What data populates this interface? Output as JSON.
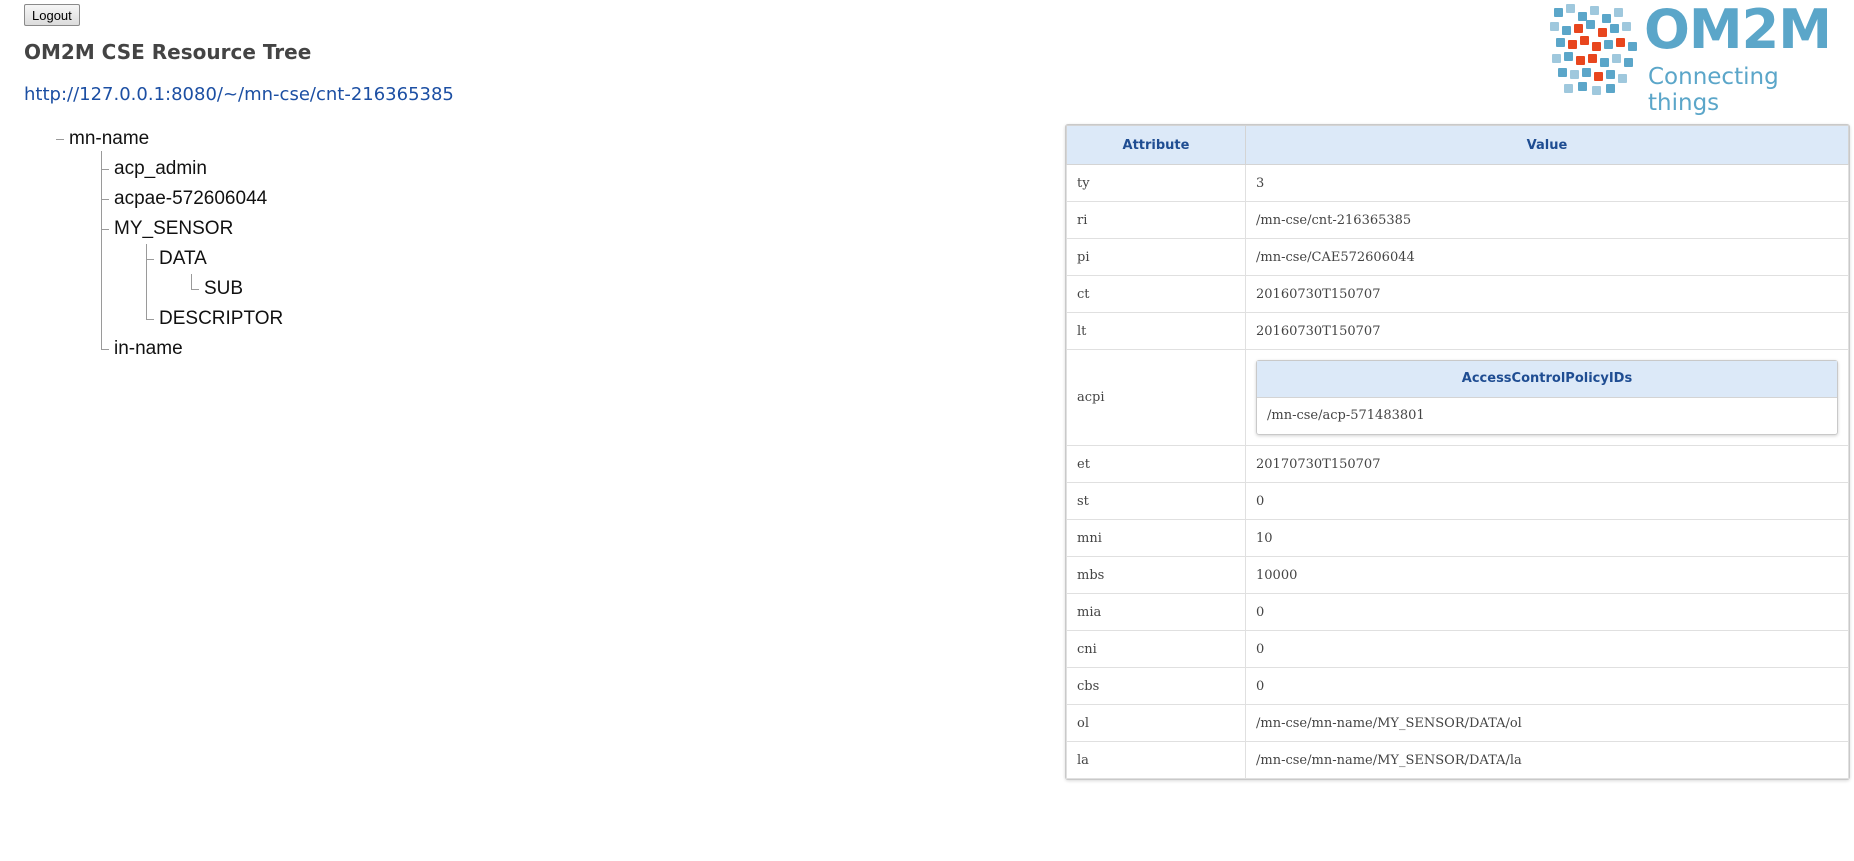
{
  "header": {
    "logout_label": "Logout",
    "title": "OM2M CSE Resource Tree",
    "url": "http://127.0.0.1:8080/~/mn-cse/cnt-216365385"
  },
  "logo": {
    "word": "OM2M",
    "tagline": "Connecting things",
    "colors": {
      "primary": "#5ba6c9",
      "accent": "#e8461e"
    }
  },
  "tree": {
    "nodes": [
      "mn-name",
      "acp_admin",
      "acpae-572606044",
      "MY_SENSOR",
      "DATA",
      "SUB",
      "DESCRIPTOR",
      "in-name"
    ]
  },
  "attributes": {
    "headers": {
      "attribute": "Attribute",
      "value": "Value"
    },
    "rows": [
      {
        "key": "ty",
        "value": "3"
      },
      {
        "key": "ri",
        "value": "/mn-cse/cnt-216365385"
      },
      {
        "key": "pi",
        "value": "/mn-cse/CAE572606044"
      },
      {
        "key": "ct",
        "value": "20160730T150707"
      },
      {
        "key": "lt",
        "value": "20160730T150707"
      },
      {
        "key": "acpi",
        "value": ""
      },
      {
        "key": "et",
        "value": "20170730T150707"
      },
      {
        "key": "st",
        "value": "0"
      },
      {
        "key": "mni",
        "value": "10"
      },
      {
        "key": "mbs",
        "value": "10000"
      },
      {
        "key": "mia",
        "value": "0"
      },
      {
        "key": "cni",
        "value": "0"
      },
      {
        "key": "cbs",
        "value": "0"
      },
      {
        "key": "ol",
        "value": "/mn-cse/mn-name/MY_SENSOR/DATA/ol"
      },
      {
        "key": "la",
        "value": "/mn-cse/mn-name/MY_SENSOR/DATA/la"
      }
    ],
    "acpi": {
      "header": "AccessControlPolicyIDs",
      "ids": [
        "/mn-cse/acp-571483801"
      ]
    }
  }
}
